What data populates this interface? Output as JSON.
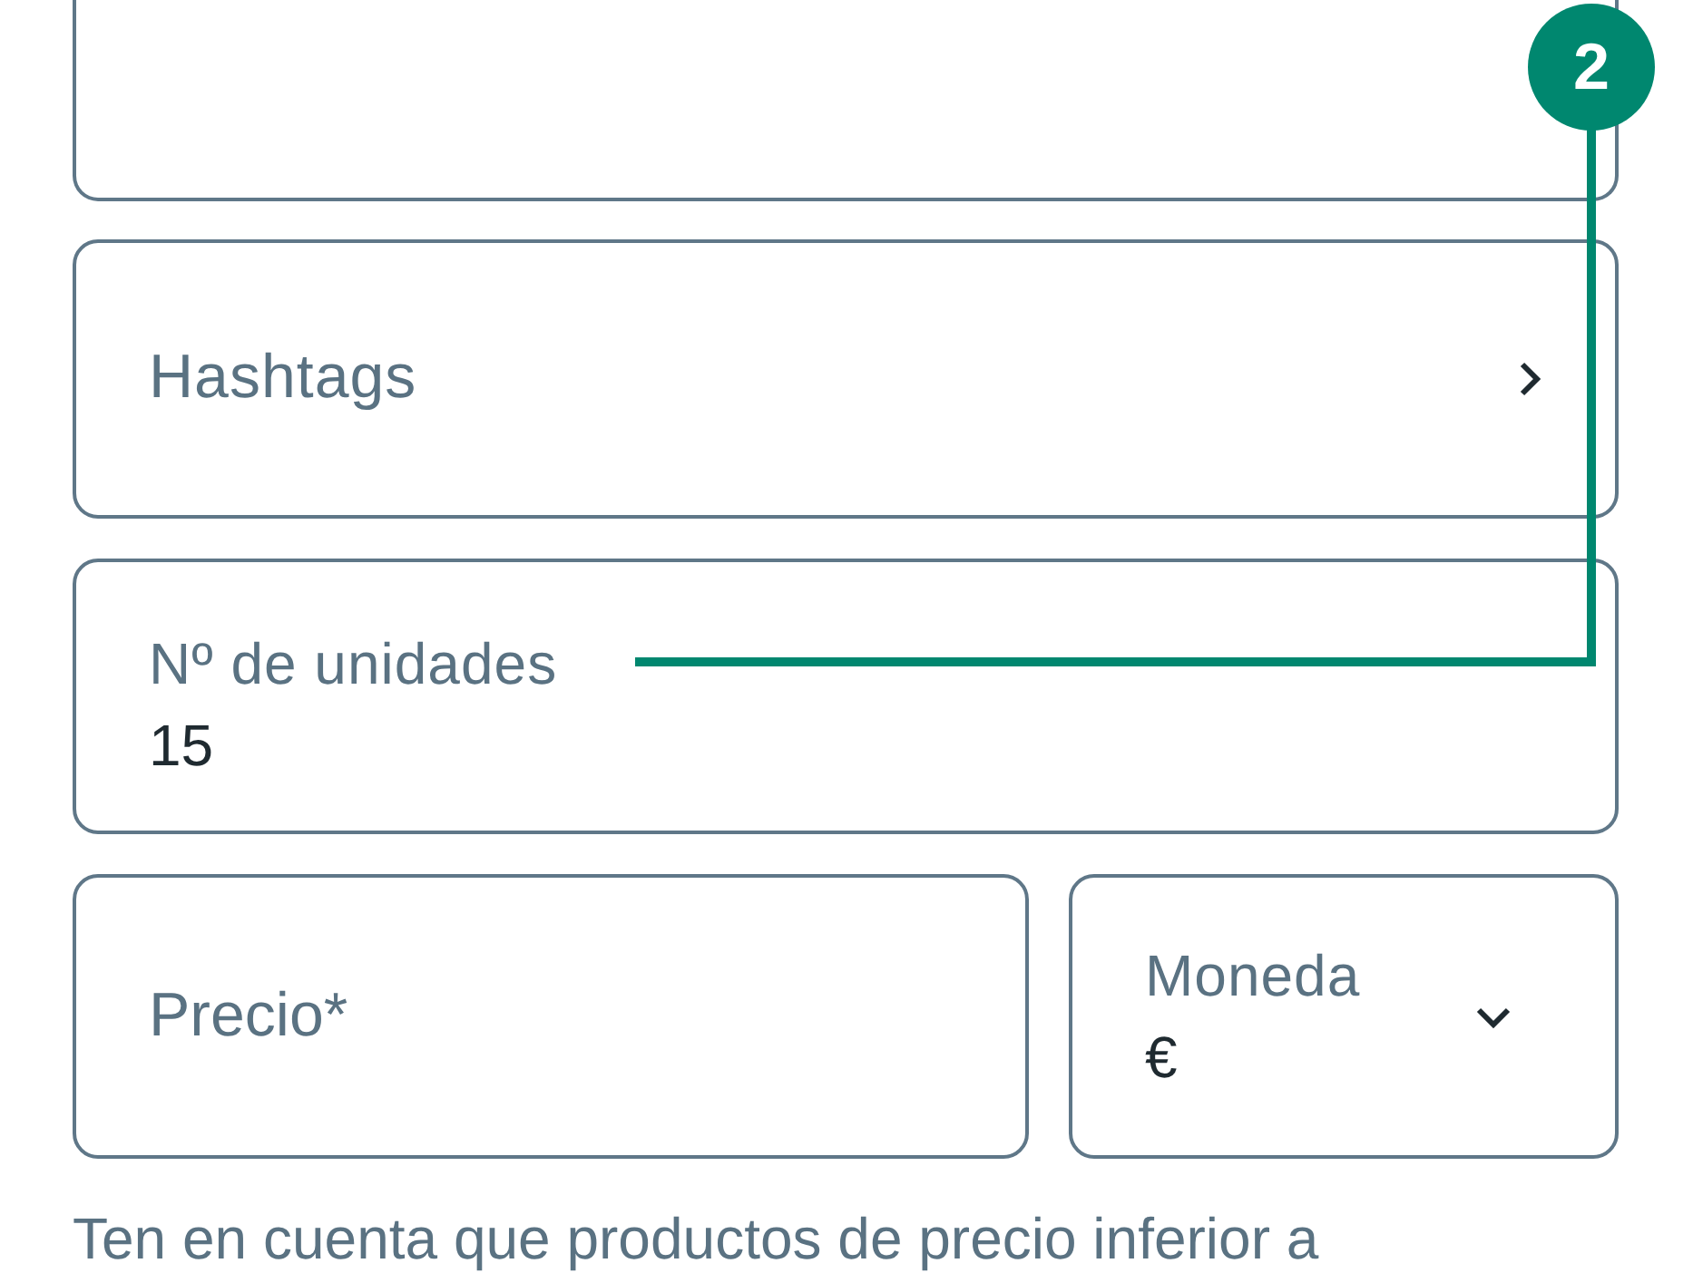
{
  "fields": [
    {
      "kind": "empty"
    },
    {
      "kind": "link",
      "label": "Hashtags"
    },
    {
      "kind": "text",
      "label": "Nº de unidades",
      "value": "15"
    }
  ],
  "price_row": [
    {
      "kind": "input",
      "placeholder": "Precio*"
    },
    {
      "kind": "select",
      "label": "Moneda",
      "value": "€"
    }
  ],
  "note": "Ten en cuenta que productos de precio inferior a",
  "callout": {
    "number": "2"
  }
}
